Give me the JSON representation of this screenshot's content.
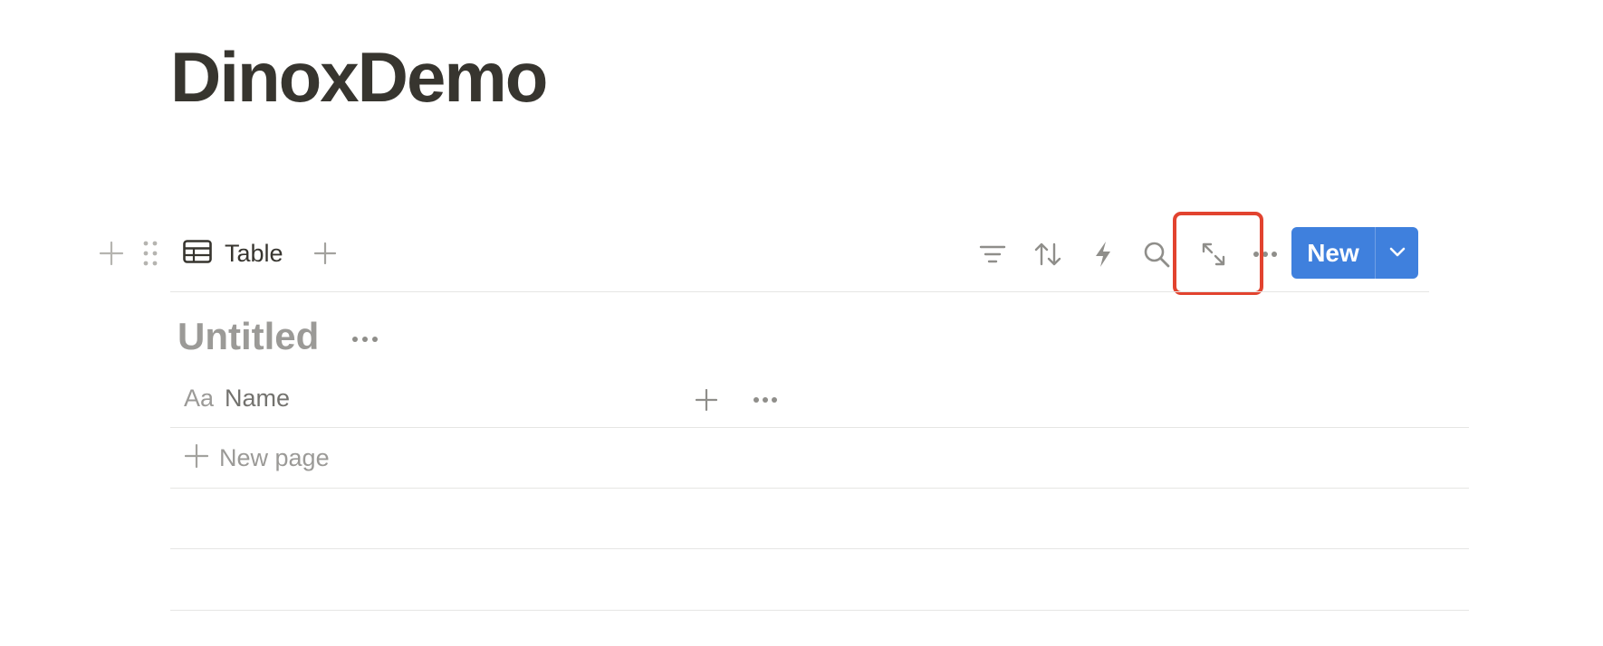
{
  "page": {
    "title": "DinoxDemo"
  },
  "toolbar": {
    "view_tab_label": "Table",
    "new_button_label": "New",
    "icons": [
      "plus-icon",
      "drag-handle-icon",
      "table-icon",
      "plus-icon",
      "filter-icon",
      "sort-icon",
      "lightning-icon",
      "search-icon",
      "expand-icon",
      "more-icon",
      "chevron-down-icon"
    ]
  },
  "table": {
    "group_title": "Untitled",
    "columns": [
      {
        "icon": "Aa",
        "label": "Name"
      }
    ],
    "new_page_label": "New page"
  },
  "colors": {
    "accent": "#3f80dd",
    "highlight": "#e2432f",
    "text": "#37352f",
    "muted": "#9b9a97"
  }
}
